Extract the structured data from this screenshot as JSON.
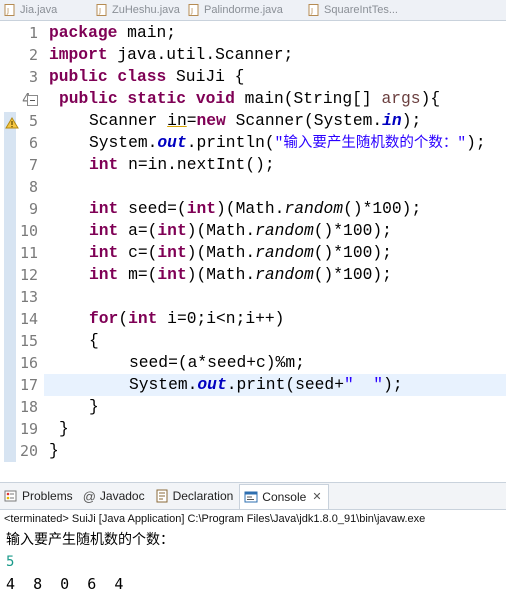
{
  "editor_tabs": [
    {
      "label": "Jia.java"
    },
    {
      "label": "ZuHeshu.java"
    },
    {
      "label": "Palindorme.java"
    },
    {
      "label": "SquareIntTes..."
    }
  ],
  "line_numbers": [
    "1",
    "2",
    "3",
    "4",
    "5",
    "6",
    "7",
    "8",
    "9",
    "10",
    "11",
    "12",
    "13",
    "14",
    "15",
    "16",
    "17",
    "18",
    "19",
    "20"
  ],
  "code": {
    "l1_kw": "package",
    "l1_rest": " main;",
    "l2_kw": "import",
    "l2_rest": " java.util.Scanner;",
    "l3_kw1": "public",
    "l3_kw2": "class",
    "l3_rest": " SuiJi {",
    "l4_kw1": "public",
    "l4_kw2": "static",
    "l4_kw3": "void",
    "l4_a": " main(String[] ",
    "l4_var": "args",
    "l4_b": "){",
    "l5_a": "Scanner ",
    "l5_in": "in",
    "l5_b": "=",
    "l5_kw": "new",
    "l5_c": " Scanner(System.",
    "l5_fld": "in",
    "l5_d": ");",
    "l6_a": "System.",
    "l6_fld": "out",
    "l6_b": ".println(",
    "l6_str": "\"输入要产生随机数的个数：\"",
    "l6_c": ");",
    "l7_kw": "int",
    "l7_rest": " n=in.nextInt();",
    "l9_kw1": "int",
    "l9_a": " seed=(",
    "l9_kw2": "int",
    "l9_b": ")(Math.",
    "l9_m": "random",
    "l9_c": "()*100);",
    "l10_kw1": "int",
    "l10_a": " a=(",
    "l10_kw2": "int",
    "l10_b": ")(Math.",
    "l10_m": "random",
    "l10_c": "()*100);",
    "l11_kw1": "int",
    "l11_a": " c=(",
    "l11_kw2": "int",
    "l11_b": ")(Math.",
    "l11_m": "random",
    "l11_c": "()*100);",
    "l12_kw1": "int",
    "l12_a": " m=(",
    "l12_kw2": "int",
    "l12_b": ")(Math.",
    "l12_m": "random",
    "l12_c": "()*100);",
    "l14_kw1": "for",
    "l14_a": "(",
    "l14_kw2": "int",
    "l14_b": " i=0;i<n;i++)",
    "l15": "{",
    "l16": "seed=(a*seed+c)%m;",
    "l17_a": "System.",
    "l17_fld": "out",
    "l17_b": ".print(seed+",
    "l17_str": "\"  \"",
    "l17_c": ");",
    "l18": "}",
    "l19": "}",
    "l20": "}"
  },
  "views": {
    "problems": "Problems",
    "javadoc": "Javadoc",
    "declaration": "Declaration",
    "console": "Console",
    "console_close": "✕"
  },
  "console": {
    "header": "<terminated> SuiJi [Java Application] C:\\Program Files\\Java\\jdk1.8.0_91\\bin\\javaw.exe",
    "line1": "输入要产生随机数的个数：",
    "input": "5",
    "output": "4  8  0  6  4"
  },
  "colors": {
    "keyword": "#7f0055",
    "string": "#2a00ff",
    "field": "#0000c0",
    "console_input": "#1a9a8a",
    "current_line": "#e8f2fe"
  }
}
